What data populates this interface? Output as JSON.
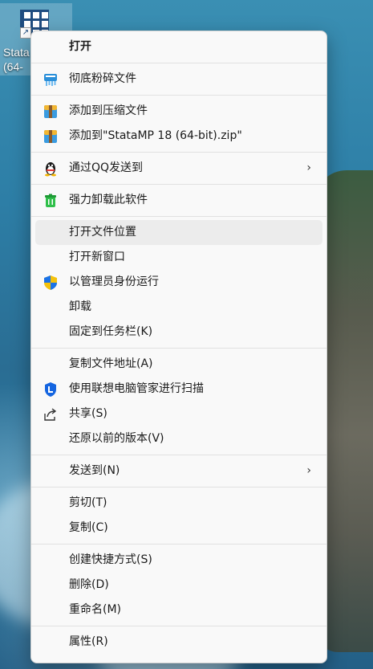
{
  "desktop": {
    "icon_label_line1": "Stata",
    "icon_label_line2": "(64-"
  },
  "menu": {
    "open": "打开",
    "shred": "彻底粉碎文件",
    "add_to_archive": "添加到压缩文件",
    "add_to_zip": "添加到\"StataMP 18 (64-bit).zip\"",
    "send_via_qq": "通过QQ发送到",
    "force_uninstall": "强力卸载此软件",
    "open_file_location": "打开文件位置",
    "open_new_window": "打开新窗口",
    "run_as_admin": "以管理员身份运行",
    "uninstall": "卸载",
    "pin_taskbar": "固定到任务栏(K)",
    "copy_path": "复制文件地址(A)",
    "lenovo_scan": "使用联想电脑管家进行扫描",
    "share": "共享(S)",
    "restore_previous": "还原以前的版本(V)",
    "send_to": "发送到(N)",
    "cut": "剪切(T)",
    "copy": "复制(C)",
    "create_shortcut": "创建快捷方式(S)",
    "delete": "删除(D)",
    "rename": "重命名(M)",
    "properties": "属性(R)",
    "submenu_arrow": "›"
  },
  "icons": {
    "shred": "shredder-icon",
    "archive": "winrar-archive-icon",
    "qq": "qq-penguin-icon",
    "uninstall": "green-trash-icon",
    "admin": "uac-shield-icon",
    "lenovo": "lenovo-shield-icon",
    "share": "share-icon"
  },
  "colors": {
    "menu_bg": "#f9f9f9",
    "highlight": "#ececec",
    "separator": "#e1e1e1",
    "stata_blue": "#1f4d80"
  }
}
